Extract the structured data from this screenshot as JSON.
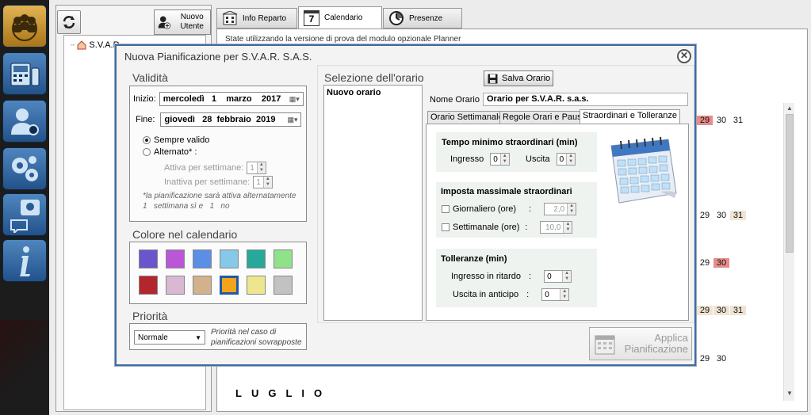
{
  "toolbar": {
    "new_user_label": "Nuovo Utente"
  },
  "tabs": [
    {
      "label": "Info Reparto",
      "icon": "building-icon"
    },
    {
      "label": "Calendario",
      "icon": "calendar-icon",
      "badge": "7"
    },
    {
      "label": "Presenze",
      "icon": "clock-icon"
    }
  ],
  "tree": {
    "root_label": "S.V.A.R..."
  },
  "status": {
    "text": "State utilizzando la versione di prova del modulo opzionale Planner"
  },
  "calendar": {
    "rows": [
      {
        "days": [
          "29",
          "30",
          "31"
        ]
      },
      {
        "days": [
          "29",
          "30",
          "31"
        ]
      },
      {
        "days": [
          "29",
          "30"
        ]
      },
      {
        "days": [
          "29",
          "30",
          "31"
        ]
      },
      {
        "days": [
          "29",
          "30"
        ]
      }
    ],
    "month_label": "LUGLIO"
  },
  "dialog": {
    "title": "Nuova Pianificazione per S.V.A.R. S.A.S.",
    "validity": {
      "title": "Validità",
      "start_label": "Inizio:",
      "start_value": "mercoledì   1    marzo    2017",
      "end_label": "Fine:",
      "end_value": "giovedì   28  febbraio  2019",
      "always_valid": "Sempre valido",
      "alternate": "Alternato* :",
      "active_weeks_label": "Attiva per settimane:",
      "active_weeks_value": "1",
      "inactive_weeks_label": "Inattiva per settimane:",
      "inactive_weeks_value": "1",
      "note_line1": "*la pianificazione sarà attiva alternatamente",
      "note_line2": "1   settimana sì e   1   no"
    },
    "color": {
      "title": "Colore nel calendario",
      "swatches": [
        "#6a55cc",
        "#b957d6",
        "#5b8fe6",
        "#86c8e8",
        "#27a99a",
        "#8fe28a",
        "#b3262b",
        "#d9b8d4",
        "#d1b28d",
        "#f5a31a",
        "#eee68e",
        "#c2c2c2"
      ],
      "selected_index": 9
    },
    "priority": {
      "title": "Priorità",
      "value": "Normale",
      "note": "Priorità nel caso di pianificazioni sovrapposte"
    },
    "schedule": {
      "title": "Selezione dell'orario",
      "save_label": "Salva Orario",
      "list_items": [
        "Nuovo orario"
      ],
      "name_label": "Nome Orario",
      "name_value": "Orario per S.V.A.R. s.a.s.",
      "subtabs": [
        "Orario Settimanale",
        "Regole Orari e Pause",
        "Straordinari e Tolleranze"
      ],
      "overtime_min_title": "Tempo minimo straordinari (min)",
      "entry_label": "Ingresso",
      "entry_value": "0",
      "exit_label": "Uscita",
      "exit_value": "0",
      "overtime_max_title": "Imposta massimale straordinari",
      "daily_label": "Giornaliero (ore)",
      "daily_value": "2,0",
      "weekly_label": "Settimanale (ore)",
      "weekly_value": "10,0",
      "colon": ":",
      "tolerance_title": "Tolleranze (min)",
      "late_label": "Ingresso in ritardo",
      "late_value": "0",
      "early_label": "Uscita in anticipo",
      "early_value": "0"
    },
    "apply_label_1": "Applica",
    "apply_label_2": "Pianificazione"
  }
}
